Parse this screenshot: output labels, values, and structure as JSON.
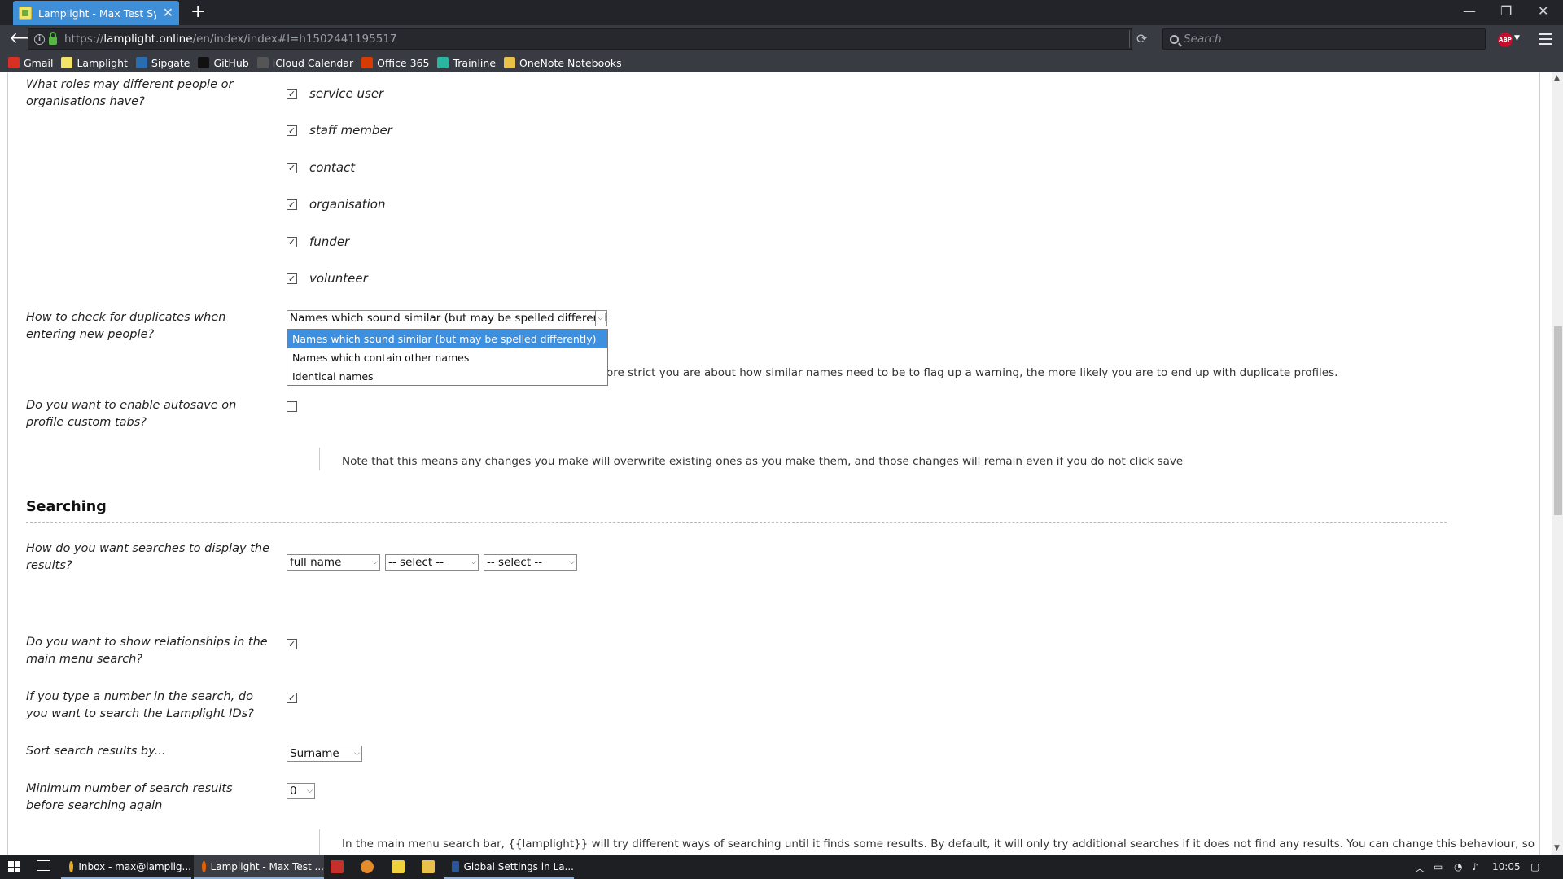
{
  "browser": {
    "tab_title": "Lamplight - Max Test System",
    "url_prefix": "https://",
    "url_domain": "lamplight.online",
    "url_path": "/en/index/index#l=h1502441195517",
    "search_placeholder": "Search",
    "abp_label": "ABP",
    "new_tab_glyph": "+",
    "bookmarks": [
      {
        "label": "Gmail",
        "icon": "gmail-icon",
        "color": "#d93025"
      },
      {
        "label": "Lamplight",
        "icon": "lamplight-icon",
        "color": "#f2e46b"
      },
      {
        "label": "Sipgate",
        "icon": "sipgate-icon",
        "color": "#2b6cb0"
      },
      {
        "label": "GitHub",
        "icon": "github-icon",
        "color": "#111111"
      },
      {
        "label": "iCloud Calendar",
        "icon": "apple-icon",
        "color": "#555555"
      },
      {
        "label": "Office 365",
        "icon": "office-icon",
        "color": "#d83b01"
      },
      {
        "label": "Trainline",
        "icon": "trainline-icon",
        "color": "#2bb4a0"
      },
      {
        "label": "OneNote Notebooks",
        "icon": "folder-icon",
        "color": "#e8c14a"
      }
    ]
  },
  "form": {
    "roles": {
      "label": "What roles may different people or organisations have?",
      "items": [
        {
          "label": "service user",
          "checked": true
        },
        {
          "label": "staff member",
          "checked": true
        },
        {
          "label": "contact",
          "checked": true
        },
        {
          "label": "organisation",
          "checked": true
        },
        {
          "label": "funder",
          "checked": true
        },
        {
          "label": "volunteer",
          "checked": true
        }
      ]
    },
    "duplicates": {
      "label": "How to check for duplicates when entering new people?",
      "selected": "Names which sound similar (but may be spelled differently)",
      "options": [
        "Names which sound similar (but may be spelled differently)",
        "Names which contain other names",
        "Identical names"
      ],
      "note_partial": "ore strict you are about how similar names need to be to flag up a warning, the more likely you are to end up with duplicate profiles."
    },
    "autosave": {
      "label": "Do you want to enable autosave on profile custom tabs?",
      "checked": false,
      "note": "Note that this means any changes you make will overwrite existing ones as you make them, and those changes will remain even if you do not click save"
    },
    "searching_heading": "Searching",
    "search_display": {
      "label": "How do you want searches to display the results?",
      "selects": [
        "full name",
        "-- select --",
        "-- select --"
      ]
    },
    "relationships": {
      "label": "Do you want to show relationships in the main menu search?",
      "checked": true
    },
    "lamplight_ids": {
      "label": "If you type a number in the search, do you want to search the Lamplight IDs?",
      "checked": true
    },
    "sort_by": {
      "label": "Sort search results by...",
      "value": "Surname"
    },
    "min_results": {
      "label": "Minimum number of search results before searching again",
      "value": "0"
    },
    "search_note": "In the main menu search bar, {{lamplight}} will try different ways of searching until it finds some results. By default, it will only try additional searches if it does not find any results. You can change this behaviour, so"
  },
  "taskbar": {
    "items": [
      {
        "label": "Inbox - max@lamplig...",
        "icon": "chrome-icon",
        "color": "#e9a925"
      },
      {
        "label": "Lamplight - Max Test ...",
        "icon": "firefox-icon",
        "color": "#e66000"
      },
      {
        "label": "Global Settings in La...",
        "icon": "word-icon",
        "color": "#2b579a"
      }
    ],
    "clock": "10:05"
  }
}
